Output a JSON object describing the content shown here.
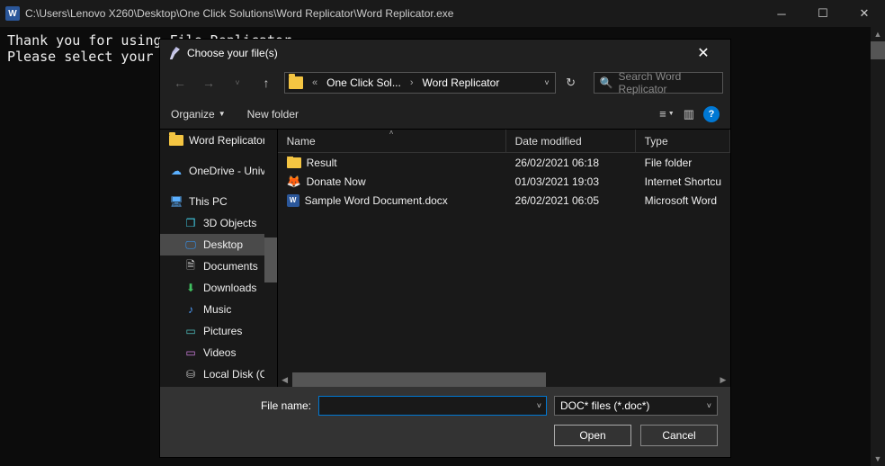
{
  "parent": {
    "title": "C:\\Users\\Lenovo X260\\Desktop\\One Click Solutions\\Word Replicator\\Word Replicator.exe",
    "console_line1": "Thank you for using File Replicator",
    "console_line2": "Please select your"
  },
  "dialog": {
    "title": "Choose your file(s)",
    "breadcrumb": {
      "seg1": "One Click Sol...",
      "seg2": "Word Replicator"
    },
    "search_placeholder": "Search Word Replicator",
    "toolbar": {
      "organize": "Organize",
      "newfolder": "New folder"
    },
    "tree": {
      "items": [
        {
          "label": "Word Replicator",
          "icon": "folder",
          "sub": false
        },
        {
          "label": "OneDrive - Univer",
          "icon": "cloud",
          "sub": false
        },
        {
          "label": "This PC",
          "icon": "pc",
          "sub": false
        },
        {
          "label": "3D Objects",
          "icon": "cube",
          "sub": true
        },
        {
          "label": "Desktop",
          "icon": "desktop",
          "sub": true,
          "selected": true
        },
        {
          "label": "Documents",
          "icon": "doc",
          "sub": true
        },
        {
          "label": "Downloads",
          "icon": "down",
          "sub": true
        },
        {
          "label": "Music",
          "icon": "music",
          "sub": true
        },
        {
          "label": "Pictures",
          "icon": "pic",
          "sub": true
        },
        {
          "label": "Videos",
          "icon": "vid",
          "sub": true
        },
        {
          "label": "Local Disk (C:)",
          "icon": "disk",
          "sub": true
        }
      ]
    },
    "headers": {
      "name": "Name",
      "date": "Date modified",
      "type": "Type"
    },
    "rows": [
      {
        "name": "Result",
        "date": "26/02/2021 06:18",
        "type": "File folder",
        "icon": "folder"
      },
      {
        "name": "Donate Now",
        "date": "01/03/2021 19:03",
        "type": "Internet Shortcu",
        "icon": "ff"
      },
      {
        "name": "Sample Word Document.docx",
        "date": "26/02/2021 06:05",
        "type": "Microsoft Word",
        "icon": "word"
      }
    ],
    "footer": {
      "filename_label": "File name:",
      "filename_value": "",
      "filetype": "DOC* files (*.doc*)",
      "open": "Open",
      "cancel": "Cancel"
    }
  }
}
